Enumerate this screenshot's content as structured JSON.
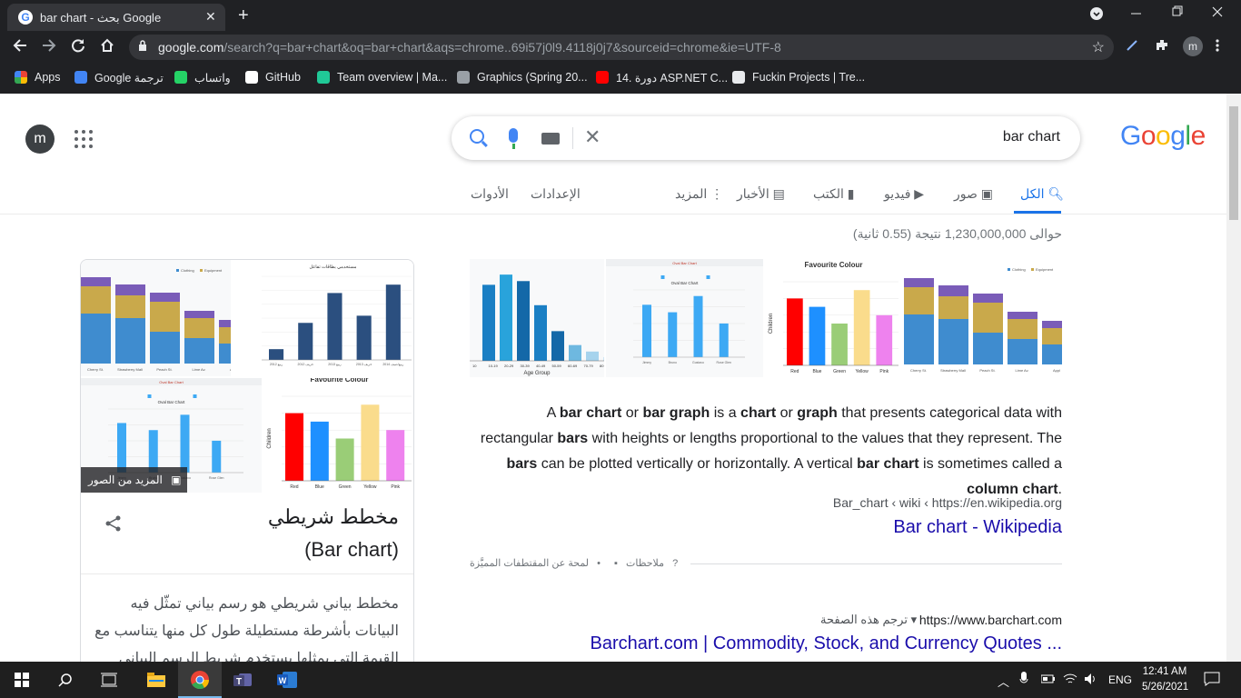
{
  "browser": {
    "tab_title": "bar chart - بحث Google",
    "tab_close": "✕",
    "new_tab": "+",
    "url_host": "google.com",
    "url_path": "/search?q=bar+chart&oq=bar+chart&aqs=chrome..69i57j0l9.4118j0j7&sourceid=chrome&ie=UTF-8",
    "profile_initial": "m",
    "bookmarks": [
      {
        "label": "Apps",
        "icon": "apps-grid-icon",
        "color": "#e8eaed"
      },
      {
        "label": "Google ترجمة",
        "icon": "translate-icon",
        "color": "#4285f4"
      },
      {
        "label": "واتساب",
        "icon": "whatsapp-icon",
        "color": "#25d366"
      },
      {
        "label": "GitHub",
        "icon": "github-icon",
        "color": "#ffffff"
      },
      {
        "label": "Team overview | Ma...",
        "icon": "diamond-icon",
        "color": "#20c997"
      },
      {
        "label": "Graphics (Spring 20...",
        "icon": "graphics-icon",
        "color": "#9aa0a6"
      },
      {
        "label": "14. دورة ASP.NET C...",
        "icon": "youtube-icon",
        "color": "#ff0000"
      },
      {
        "label": "Fuckin Projects | Tre...",
        "icon": "trello-icon",
        "color": "#e8eaed"
      }
    ]
  },
  "header": {
    "avatar_initial": "m",
    "query": "bar chart",
    "logo": [
      {
        "ch": "G",
        "color": "#4285f4"
      },
      {
        "ch": "o",
        "color": "#ea4335"
      },
      {
        "ch": "o",
        "color": "#fbbc05"
      },
      {
        "ch": "g",
        "color": "#4285f4"
      },
      {
        "ch": "l",
        "color": "#34a853"
      },
      {
        "ch": "e",
        "color": "#ea4335"
      }
    ]
  },
  "tabs": {
    "all": "الكل",
    "images": "صور",
    "videos": "فيديو",
    "books": "الكتب",
    "news": "الأخبار",
    "more": "المزيد",
    "settings": "الإعدادات",
    "tools": "الأدوات"
  },
  "results": {
    "stats": "حوالى 1,230,000,000 نتيجة (0.55 ثانية)",
    "snippet_html": "A <b>bar chart</b> or <b>bar graph</b> is a <b>chart</b> or <b>graph</b> that presents categorical data with rectangular <b>bars</b> with heights or lengths proportional to the values that they represent. The <b>bars</b> can be plotted vertically or horizontally. A vertical <b>bar chart</b> is sometimes called a <b>column chart</b>.",
    "wiki_cite": "Bar_chart ‹ wiki ‹ https://en.wikipedia.org",
    "wiki_title": "Bar chart - Wikipedia",
    "feedback_about": "لمحة عن المقتطفات المميَّزة",
    "feedback": "ملاحظات",
    "bullet": "•",
    "second_cite": "https://www.barchart.com",
    "translate_page": "ترجم هذه الصفحة",
    "second_title": "Barchart.com | Commodity, Stock, and Currency Quotes ..."
  },
  "thumbs": {
    "age_group_label": "Age Group",
    "age_ticks": [
      "10",
      "10-19",
      "20-29",
      "30-39",
      "40-49",
      "50-59",
      "60-69",
      "70-79",
      "80+"
    ],
    "age_values": [
      0.82,
      0.93,
      0.86,
      0.6,
      0.32,
      0.17,
      0.1,
      0.04
    ],
    "fav_title": "Favourite Colour",
    "fav_ylabel": "Children",
    "fav_labels": [
      "Red",
      "Blue",
      "Green",
      "Yellow",
      "Pink"
    ],
    "fav_values": [
      8,
      7,
      5,
      9,
      6
    ],
    "fav_colors": [
      "#ff0000",
      "#1e90ff",
      "#9acd77",
      "#fadc8c",
      "#ee82ee"
    ],
    "stack_legend": [
      "Clothing",
      "Equipment"
    ],
    "stack_labels": [
      "Cherry St.",
      "Strawberry Mall",
      "Peach St.",
      "Lime Av.",
      "Appl"
    ],
    "oval_title": "Oval Bar Chart",
    "oval_values": [
      4.2,
      3.6,
      4.9,
      2.7
    ],
    "oval_labels": [
      "Jimmy",
      "Bruno",
      "Gustavo",
      "Rose Glen"
    ],
    "arabic_chart_title": "مستخدمي بطاقات تفاعل",
    "arabic_chart_values": [
      1.8,
      6.2,
      11.2,
      7.4,
      12.6
    ],
    "arabic_chart_labels": [
      "ربيع 2012",
      "خريف 2012",
      "ربيع 2013",
      "خريف 2013",
      "ربيع/صيف 2014"
    ]
  },
  "knowledge_panel": {
    "more_images": "المزيد من الصور",
    "title": "مخطط شريطي",
    "subtitle": "(Bar chart)",
    "description": "مخطط بياني شريطي  هو رسم بياني تمثّل فيه البيانات بأشرطة مستطيلة طول كل منها يتناسب مع القيمة التي يمثلها يستخدم شريط الرسم البياني"
  },
  "taskbar": {
    "lang": "ENG",
    "time": "12:41 AM",
    "date": "5/26/2021"
  }
}
